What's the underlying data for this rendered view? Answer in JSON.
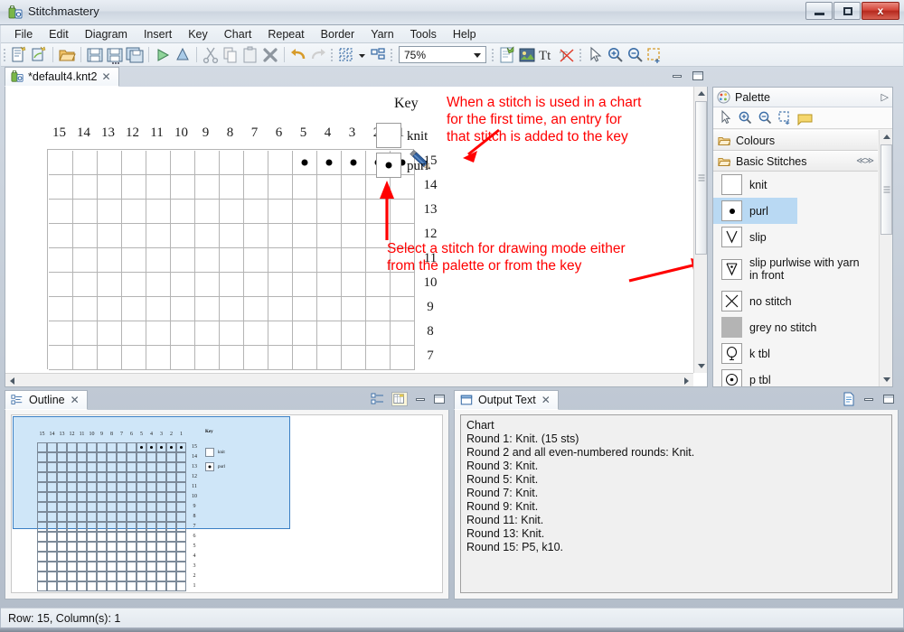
{
  "window": {
    "title": "Stitchmastery",
    "app_icon": "stitchmastery-icon",
    "minimize": "–",
    "maximize": "□",
    "close": "x"
  },
  "menu": {
    "items": [
      "File",
      "Edit",
      "Diagram",
      "Insert",
      "Key",
      "Chart",
      "Repeat",
      "Border",
      "Yarn",
      "Tools",
      "Help"
    ]
  },
  "toolbar": {
    "zoom_value": "75%",
    "buttons": [
      "new-diagram-icon",
      "new-chart-icon",
      "open-icon",
      "save-icon",
      "save-as-icon",
      "save-all-icon",
      "play-icon",
      "step-icon",
      "cut-icon",
      "copy-icon",
      "paste-icon",
      "delete-icon",
      "undo-icon",
      "redo-icon",
      "align-icon",
      "arrange-icon",
      "note-icon",
      "image-icon",
      "text-icon",
      "no-text-icon",
      "select-icon",
      "zoom-in-icon",
      "zoom-out-icon",
      "marquee-zoom-icon"
    ]
  },
  "editor": {
    "tab_label": "*default4.knt2",
    "tab_icon": "stitchmastery-file-icon",
    "tab_close": "✖",
    "minimize_label": "Minimize",
    "maximize_label": "Maximize"
  },
  "chart": {
    "columns": [
      "15",
      "14",
      "13",
      "12",
      "11",
      "10",
      "9",
      "8",
      "7",
      "6",
      "5",
      "4",
      "3",
      "2",
      "1"
    ],
    "rows_visible": [
      "15",
      "14",
      "13",
      "12",
      "11",
      "10",
      "9",
      "8",
      "7"
    ],
    "rows_all": [
      "15",
      "14",
      "13",
      "12",
      "11",
      "10",
      "9",
      "8",
      "7",
      "6",
      "5",
      "4",
      "3",
      "2",
      "1"
    ],
    "purl_row": "15",
    "purl_columns": [
      "5",
      "4",
      "3",
      "2",
      "1"
    ],
    "cursor": "pencil-cursor"
  },
  "key": {
    "title": "Key",
    "entries": [
      {
        "symbol": "knit-symbol",
        "label": "knit"
      },
      {
        "symbol": "purl-symbol",
        "label": "purl"
      }
    ]
  },
  "annotations": [
    {
      "id": "key-annotation",
      "text": "When a stitch is used in a chart for the first time, an entry for that stitch is added to the key",
      "color": "#ff0000"
    },
    {
      "id": "select-stitch-annotation",
      "text": "Select a stitch for drawing mode either from the palette or from the key",
      "color": "#ff0000"
    }
  ],
  "palette": {
    "title": "Palette",
    "pin_icon": "chevron-right-icon",
    "tools": [
      "select-tool-icon",
      "zoom-in-tool-icon",
      "zoom-out-tool-icon",
      "marquee-tool-icon",
      "note-tool-icon"
    ],
    "groups": [
      {
        "name": "Colours",
        "icon": "folder-icon",
        "items": []
      },
      {
        "name": "Basic Stitches",
        "icon": "folder-icon",
        "collapse_icon": "collapse-icon",
        "items": [
          {
            "label": "knit",
            "symbol": "knit-symbol",
            "selected": false
          },
          {
            "label": "purl",
            "symbol": "purl-symbol",
            "selected": true
          },
          {
            "label": "slip",
            "symbol": "slip-symbol",
            "selected": false
          },
          {
            "label": "slip purlwise with yarn in front",
            "symbol": "slip-purlwise-yif-symbol",
            "selected": false
          },
          {
            "label": "no stitch",
            "symbol": "no-stitch-symbol",
            "selected": false
          },
          {
            "label": "grey no stitch",
            "symbol": "grey-no-stitch-symbol",
            "selected": false
          },
          {
            "label": "k tbl",
            "symbol": "k-tbl-symbol",
            "selected": false
          },
          {
            "label": "p tbl",
            "symbol": "p-tbl-symbol",
            "selected": false
          }
        ]
      }
    ]
  },
  "outline": {
    "tab_label": "Outline",
    "tab_icon": "outline-icon",
    "tab_close": "✖",
    "toolbar": [
      "tree-view-icon",
      "thumbnail-view-icon"
    ],
    "minimize_label": "Minimize",
    "maximize_label": "Maximize",
    "key_title": "Key",
    "key_entries": [
      "knit",
      "purl"
    ]
  },
  "output": {
    "tab_label": "Output Text",
    "tab_icon": "output-text-icon",
    "tab_close": "✖",
    "toolbar": [
      "document-icon"
    ],
    "minimize_label": "Minimize",
    "maximize_label": "Maximize",
    "lines": [
      "Chart",
      "Round 1: Knit. (15 sts)",
      "Round 2 and all even-numbered rounds: Knit.",
      "Round 3: Knit.",
      "Round 5: Knit.",
      "Round 7: Knit.",
      "Round 9: Knit.",
      "Round 11: Knit.",
      "Round 13: Knit.",
      "Round 15: P5, k10."
    ]
  },
  "status": {
    "text": "Row: 15, Column(s): 1"
  },
  "colors": {
    "annotation_red": "#ff0000",
    "selection_blue": "#b9d9f3",
    "outline_highlight": "#cfe6f8",
    "grid_line": "#b4b4b4"
  }
}
